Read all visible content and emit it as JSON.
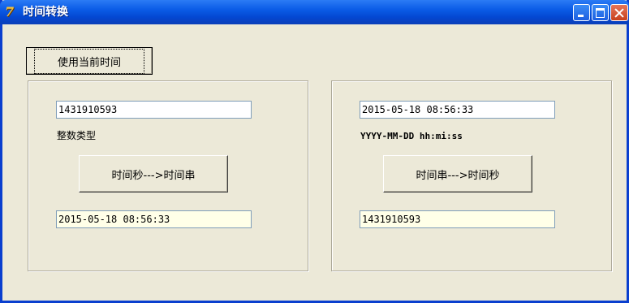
{
  "window": {
    "title": "时间转换"
  },
  "toolbar": {
    "use_current_time_label": "使用当前时间"
  },
  "left": {
    "input_value": "1431910593",
    "type_label": "整数类型",
    "convert_button": "时间秒--->时间串",
    "output_value": "2015-05-18 08:56:33"
  },
  "right": {
    "input_value": "2015-05-18 08:56:33",
    "format_label": "YYYY-MM-DD hh:mi:ss",
    "convert_button": "时间串--->时间秒",
    "output_value": "1431910593"
  },
  "colors": {
    "titlebar": "#0A5BE6",
    "window_bg": "#ECE9D8",
    "readonly_bg": "#FFFFE8"
  }
}
